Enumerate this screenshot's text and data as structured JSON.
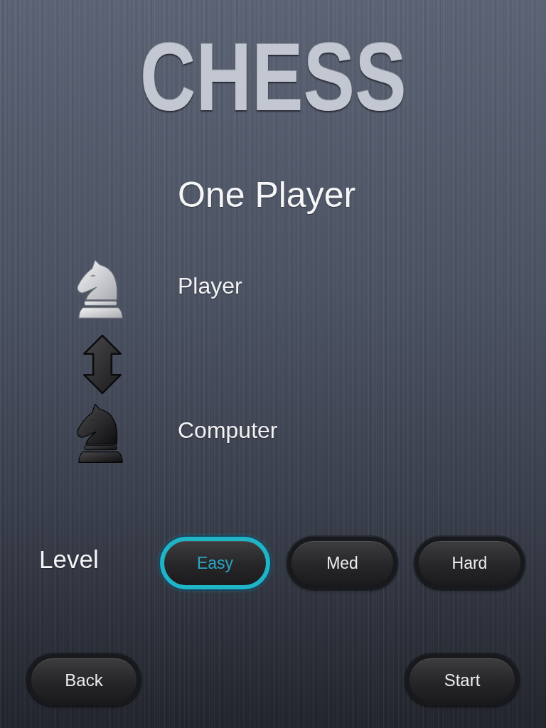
{
  "title": "CHESS",
  "mode": "One Player",
  "sides": [
    {
      "label": "Player",
      "kind": "white"
    },
    {
      "label": "Computer",
      "kind": "black"
    }
  ],
  "level": {
    "label": "Level",
    "options": [
      {
        "label": "Easy",
        "selected": true
      },
      {
        "label": "Med",
        "selected": false
      },
      {
        "label": "Hard",
        "selected": false
      }
    ]
  },
  "buttons": [
    {
      "label": "Back"
    },
    {
      "label": "Start"
    }
  ]
}
